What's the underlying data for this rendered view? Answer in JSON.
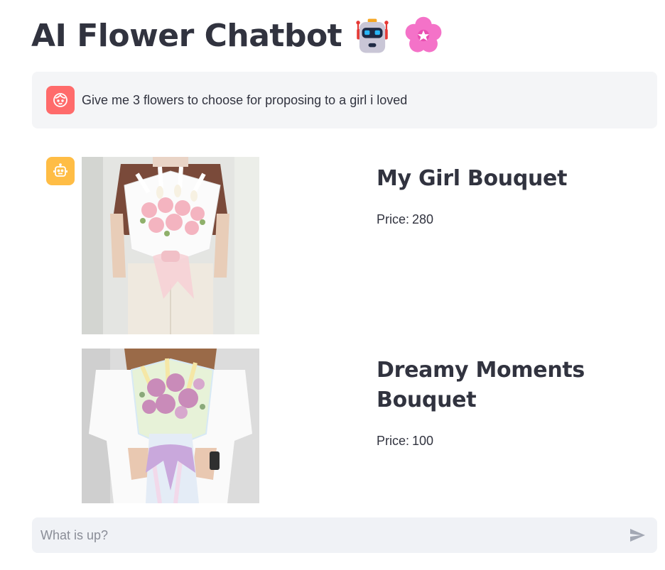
{
  "header": {
    "title": "AI Flower Chatbot",
    "robot_emoji": "robot-icon",
    "flower_emoji": "cherry-blossom-icon"
  },
  "messages": {
    "user": {
      "avatar": "user-face-icon",
      "avatar_color": "#ff6b6b",
      "text": "Give me 3 flowers to choose for proposing to a girl i loved"
    },
    "assistant": {
      "avatar": "bot-icon",
      "avatar_color": "#ffbd45",
      "products": [
        {
          "name": "My Girl Bouquet",
          "price_label": "Price:",
          "price": "280"
        },
        {
          "name": "Dreamy Moments Bouquet",
          "price_label": "Price:",
          "price": "100"
        }
      ]
    }
  },
  "chat_input": {
    "placeholder": "What is up?",
    "value": "",
    "send_icon": "send-icon"
  }
}
